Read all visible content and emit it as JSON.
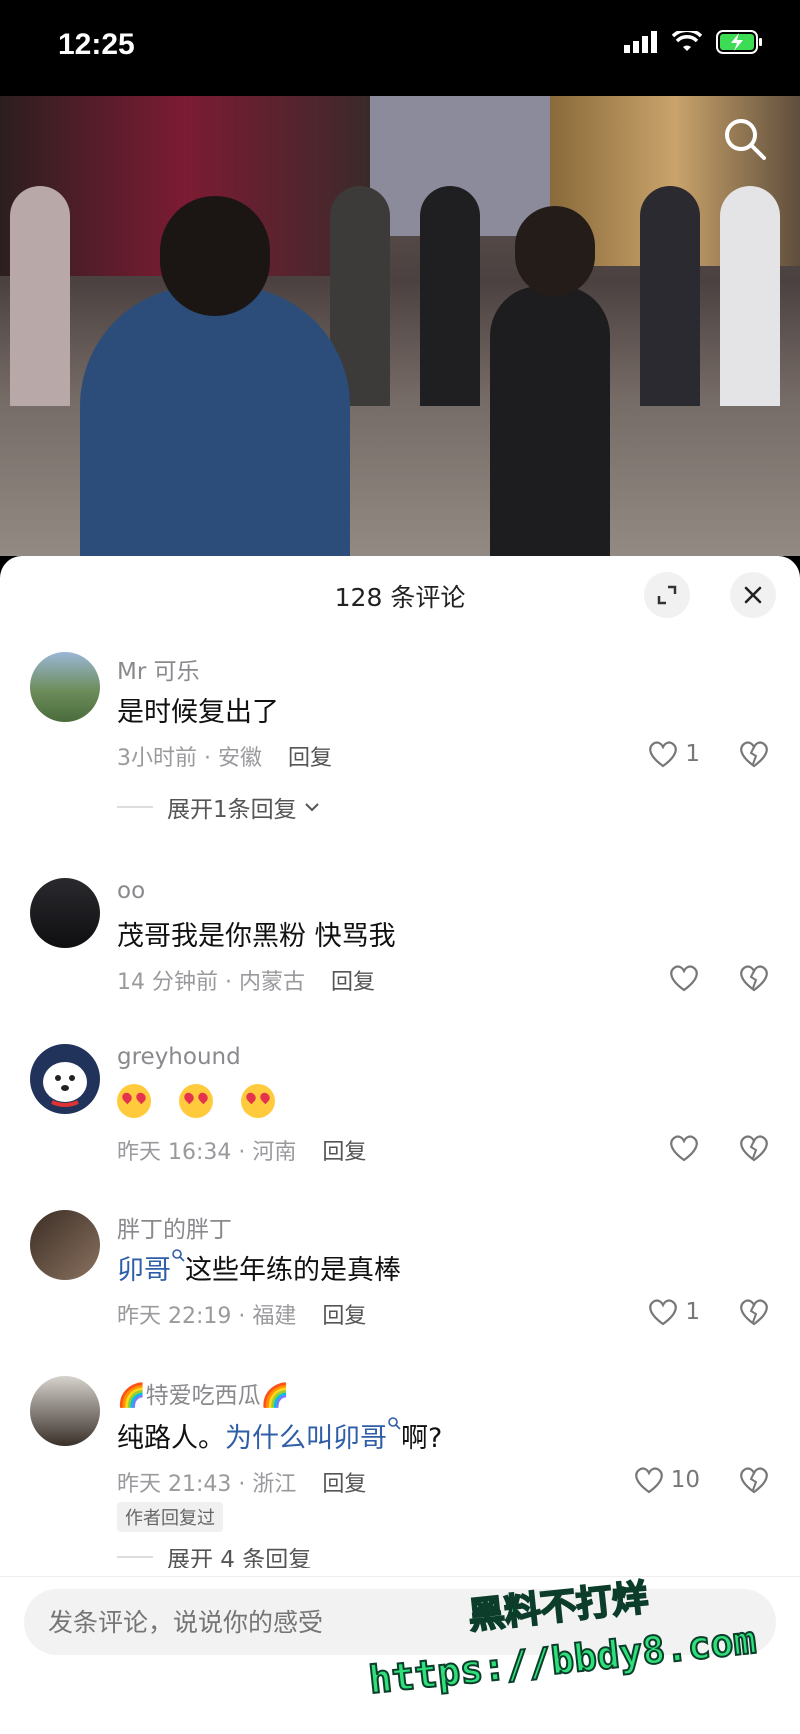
{
  "status_bar": {
    "time": "12:25"
  },
  "sheet": {
    "title": "128 条评论"
  },
  "comments": [
    {
      "user": "Mr 可乐",
      "text": "是时候复出了",
      "meta": "3小时前 · 安徽",
      "reply": "回复",
      "likes": "1",
      "expand": "展开1条回复"
    },
    {
      "user": "oo",
      "text": "茂哥我是你黑粉  快骂我",
      "meta": "14 分钟前 · 内蒙古",
      "reply": "回复",
      "likes": ""
    },
    {
      "user": "greyhound",
      "text": "",
      "meta": "昨天 16:34 · 河南",
      "reply": "回复",
      "likes": ""
    },
    {
      "user": "胖丁的胖丁",
      "text_link": "卯哥",
      "text_rest": "这些年练的是真棒",
      "meta": "昨天 22:19 · 福建",
      "reply": "回复",
      "likes": "1"
    },
    {
      "user": "特爱吃西瓜",
      "text_pre": "纯路人。",
      "text_link": "为什么叫卯哥",
      "text_post": "啊?",
      "meta": "昨天 21:43 · 浙江",
      "reply": "回复",
      "likes": "10",
      "badge": "作者回复过",
      "expand": "展开 4 条回复"
    }
  ],
  "input": {
    "placeholder": "发条评论，说说你的感受"
  },
  "watermark": {
    "line1": "黑料不打烊",
    "line2": "https://bbdy8.com"
  },
  "colors": {
    "link": "#2f5ea8",
    "watermark": "#2ee07a"
  }
}
